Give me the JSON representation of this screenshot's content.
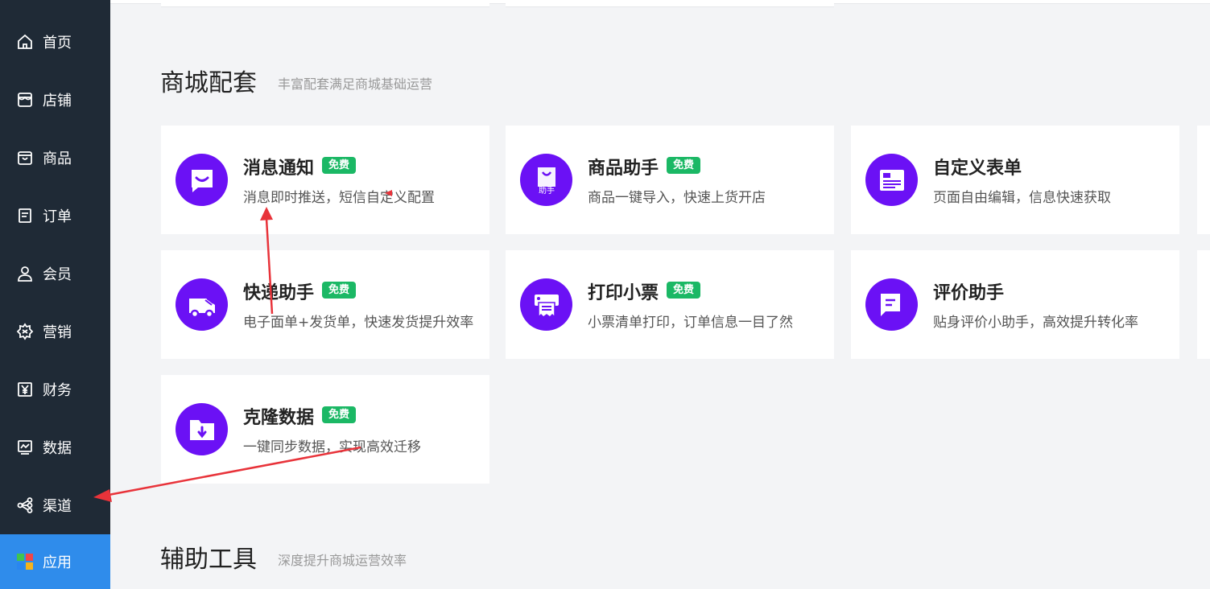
{
  "sidebar": {
    "items": [
      {
        "label": "首页",
        "icon": "home-icon"
      },
      {
        "label": "店铺",
        "icon": "store-icon"
      },
      {
        "label": "商品",
        "icon": "bag-icon"
      },
      {
        "label": "订单",
        "icon": "order-icon"
      },
      {
        "label": "会员",
        "icon": "user-icon"
      },
      {
        "label": "营销",
        "icon": "gear-icon"
      },
      {
        "label": "财务",
        "icon": "yen-icon"
      },
      {
        "label": "数据",
        "icon": "chart-icon"
      },
      {
        "label": "渠道",
        "icon": "share-icon"
      },
      {
        "label": "应用",
        "icon": "apps-icon"
      }
    ],
    "active_label": "应用"
  },
  "sections": [
    {
      "title": "商城配套",
      "subtitle": "丰富配套满足商城基础运营"
    },
    {
      "title": "辅助工具",
      "subtitle": "深度提升商城运营效率"
    }
  ],
  "cards": [
    {
      "name": "消息通知",
      "badge": "免费",
      "desc": "消息即时推送，短信自定义配置",
      "icon": "message-icon"
    },
    {
      "name": "商品助手",
      "badge": "免费",
      "desc": "商品一键导入，快速上货开店",
      "icon": "shopping-bag-icon",
      "icon_text": "助手"
    },
    {
      "name": "自定义表单",
      "badge": "",
      "desc": "页面自由编辑，信息快速获取",
      "icon": "form-icon"
    },
    {
      "name": "快递助手",
      "badge": "免费",
      "desc": "电子面单+发货单，快速发货提升效率",
      "icon": "truck-icon"
    },
    {
      "name": "打印小票",
      "badge": "免费",
      "desc": "小票清单打印，订单信息一目了然",
      "icon": "printer-icon"
    },
    {
      "name": "评价助手",
      "badge": "",
      "desc": "贴身评价小助手，高效提升转化率",
      "icon": "comment-icon"
    },
    {
      "name": "克隆数据",
      "badge": "免费",
      "desc": "一键同步数据，实现高效迁移",
      "icon": "folder-download-icon"
    }
  ],
  "colors": {
    "sidebar_bg": "#1f2a36",
    "active": "#2f8ceb",
    "icon_bg": "#6b11f5",
    "badge": "#1bb865",
    "annotation_arrow": "#e8333a"
  }
}
